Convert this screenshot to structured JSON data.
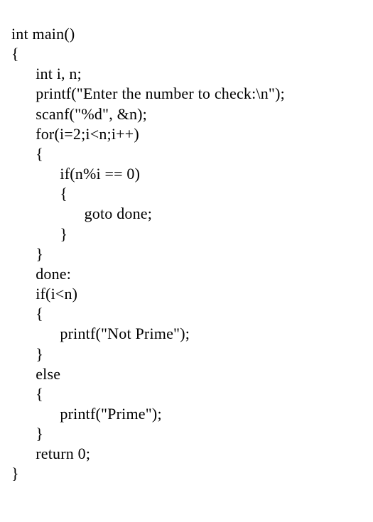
{
  "code": {
    "lines": [
      "int main()",
      "{",
      "      int i, n;",
      "      printf(\"Enter the number to check:\\n\");",
      "      scanf(\"%d\", &n);",
      "      for(i=2;i<n;i++)",
      "      {",
      "            if(n%i == 0)",
      "            {",
      "                  goto done;",
      "            }",
      "      }",
      "      done:",
      "      if(i<n)",
      "      {",
      "            printf(\"Not Prime\");",
      "      }",
      "      else",
      "      {",
      "            printf(\"Prime\");",
      "      }",
      "      return 0;",
      "}"
    ]
  }
}
